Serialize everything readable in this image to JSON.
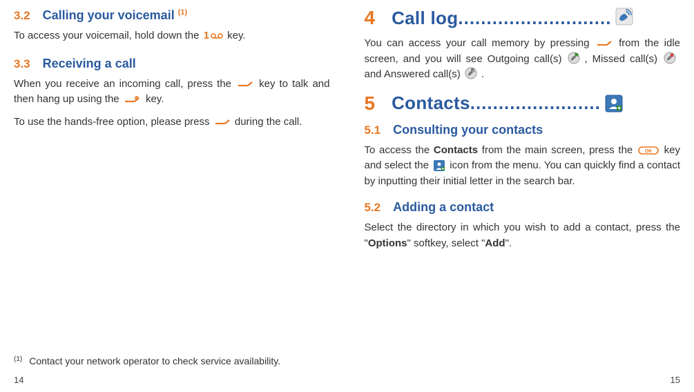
{
  "left_page": {
    "sec32": {
      "num": "3.2",
      "title": "Calling your voicemail",
      "ref": "(1)"
    },
    "p32_a": "To access your voicemail, hold down the ",
    "p32_b": " key.",
    "sec33": {
      "num": "3.3",
      "title": "Receiving a call"
    },
    "p33_a": "When you receive an incoming call, press the ",
    "p33_b": " key to talk and then hang up using the ",
    "p33_c": " key.",
    "p33_2a": "To use the hands-free option, please press  ",
    "p33_2b": "  during the call.",
    "footnote": {
      "marker": "(1)",
      "text": "Contact your network operator to check service availability."
    },
    "page_num": "14"
  },
  "right_page": {
    "chap4": {
      "num": "4",
      "title": "Call log",
      "dots": "..........................."
    },
    "p4_a": "You can access your call memory by pressing ",
    "p4_b": " from the idle screen, and you will see Outgoing call(s) ",
    "p4_c": ", Missed call(s) ",
    "p4_d": " and Answered call(s) ",
    "p4_e": ".",
    "chap5": {
      "num": "5",
      "title": "Contacts ",
      "dots": "......................."
    },
    "sec51": {
      "num": "5.1",
      "title": "Consulting your contacts"
    },
    "p51_a": "To access the ",
    "p51_bold1": "Contacts",
    "p51_b": " from the main screen, press the ",
    "p51_c": " key and select the ",
    "p51_d": " icon from the menu. You can quickly find a contact by inputting their initial letter in the search bar.",
    "sec52": {
      "num": "5.2",
      "title": "Adding a contact"
    },
    "p52_a": "Select the directory in which you wish to add a contact, press the \"",
    "p52_bold1": "Options",
    "p52_b": "\" softkey, select \"",
    "p52_bold2": "Add",
    "p52_c": "\".",
    "page_num": "15"
  }
}
